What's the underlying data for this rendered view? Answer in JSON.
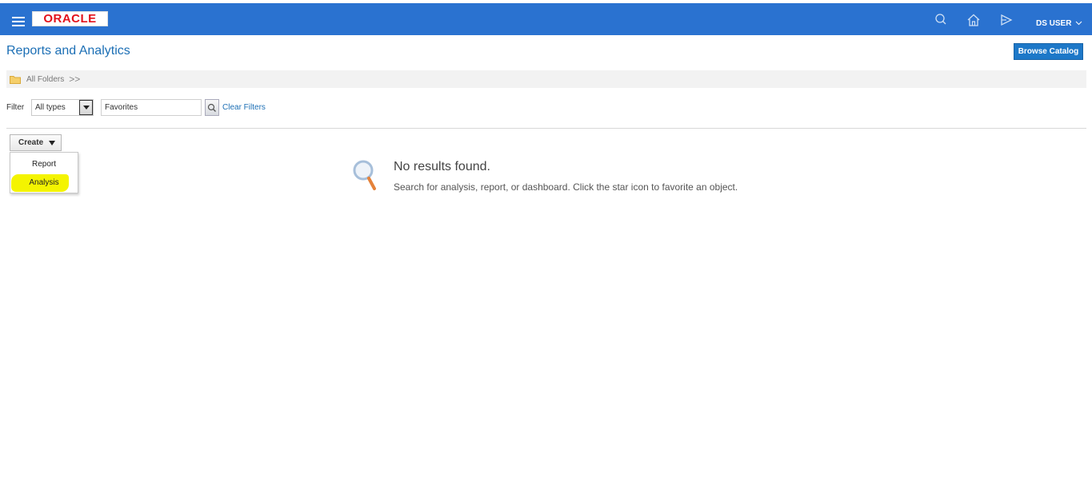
{
  "header": {
    "logo_text": "ORACLE",
    "user_label": "DS USER",
    "icons": [
      "menu-icon",
      "search-icon",
      "home-icon",
      "navigator-icon",
      "chevron-down-icon"
    ],
    "bar_color": "#2a72d0",
    "logo_color": "#e3121b"
  },
  "page": {
    "title": "Reports and Analytics",
    "browse_catalog_label": "Browse Catalog"
  },
  "breadcrumb": {
    "root_label": "All Folders",
    "separator": ">>"
  },
  "filter": {
    "label": "Filter",
    "type_value": "All types",
    "search_value": "Favorites",
    "clear_label": "Clear Filters"
  },
  "create": {
    "label": "Create",
    "menu_items": [
      {
        "label": "Report"
      },
      {
        "label": "Analysis",
        "highlighted": true
      }
    ],
    "highlight_color": "#f4f400"
  },
  "results": {
    "title": "No results found.",
    "message": "Search for analysis, report, or dashboard. Click the star icon to favorite an object."
  }
}
